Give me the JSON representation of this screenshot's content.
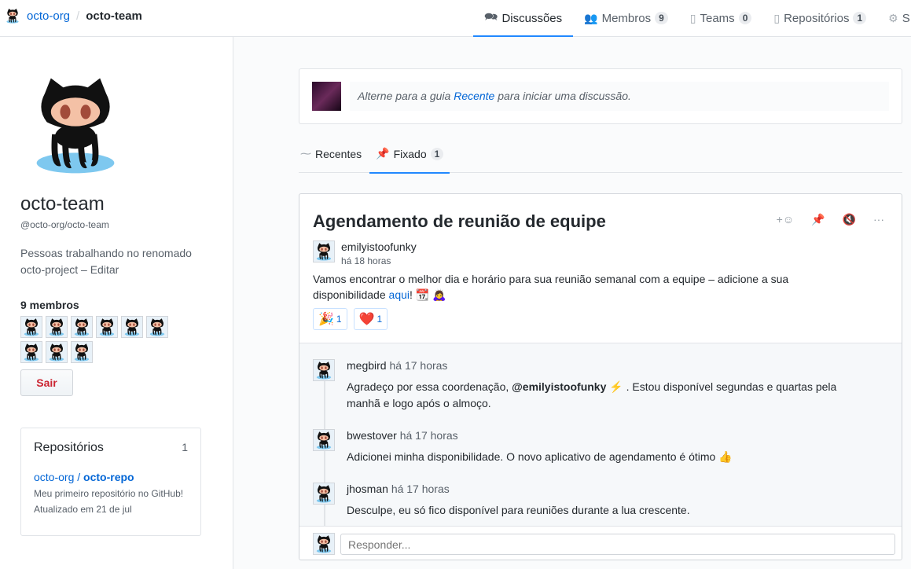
{
  "header": {
    "org": "octo-org",
    "separator": "/",
    "team": "octo-team",
    "nav": [
      {
        "label": "Discussões",
        "icon": "comment-discussion-icon",
        "active": true
      },
      {
        "label": "Membros",
        "count": "9",
        "icon": "people-icon"
      },
      {
        "label": "Teams",
        "count": "0",
        "icon": "jersey-icon"
      },
      {
        "label": "Repositórios",
        "count": "1",
        "icon": "repo-icon"
      },
      {
        "label": "S",
        "icon": "gear-icon"
      }
    ]
  },
  "sidebar": {
    "name": "octo-team",
    "slug": "@octo-org/octo-team",
    "description": "Pessoas trabalhando no renomado octo-project – Editar",
    "members_title": "9 membros",
    "member_count": 9,
    "leave_label": "Sair",
    "repos": {
      "title": "Repositórios",
      "count": "1",
      "org": "octo-org",
      "sep": " / ",
      "repo": "octo-repo",
      "description": "Meu primeiro repositório no GitHub!",
      "updated": "Atualizado em 21 de jul"
    }
  },
  "composer": {
    "pre": "Alterne para a guia ",
    "link": "Recente",
    "post": " para iniciar uma discussão."
  },
  "tabs": [
    {
      "label": "Recentes",
      "icon": "pulse-icon"
    },
    {
      "label": "Fixado",
      "count": "1",
      "icon": "pin-icon",
      "active": true
    }
  ],
  "post": {
    "title": "Agendamento de reunião de equipe",
    "author": "emilyistoofunky",
    "time": "há 18 horas",
    "body_1": "Vamos encontrar o melhor dia e horário para sua reunião semanal com a equipe – adicione a sua disponibilidade ",
    "body_link": "aqui",
    "body_2": "! 📆 🙇‍♀️",
    "reactions": [
      {
        "emoji": "🎉",
        "count": "1"
      },
      {
        "emoji": "❤️",
        "count": "1"
      }
    ],
    "actions": {
      "add_reaction": "+☺",
      "pin": "📌",
      "mute": "🔇",
      "more": "···"
    }
  },
  "comments": [
    {
      "author": "megbird",
      "time": "há 17 horas",
      "pre": "Agradeço por essa coordenação, ",
      "mention": "@emilyistoofunky",
      "post": " ⚡ . Estou disponível segundas e quartas pela manhã e logo após o almoço."
    },
    {
      "author": "bwestover",
      "time": "há 17 horas",
      "pre": "Adicionei minha disponibilidade. O novo aplicativo de agendamento é ótimo ",
      "mention": "",
      "post": "👍"
    },
    {
      "author": "jhosman",
      "time": "há 17 horas",
      "pre": "Desculpe, eu só fico disponível para reuniões durante a lua crescente.",
      "mention": "",
      "post": ""
    }
  ],
  "reply": {
    "placeholder": "Responder..."
  },
  "colors": {
    "accent": "#2188ff",
    "link": "#0366d6",
    "danger": "#cb2431",
    "pin": "#f66a0a"
  }
}
